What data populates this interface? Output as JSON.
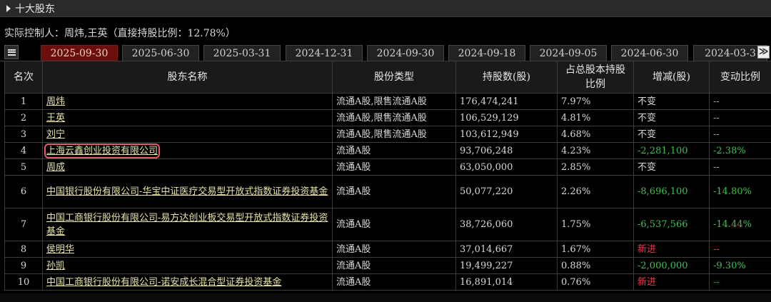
{
  "section": {
    "title": "十大股东"
  },
  "controller": {
    "text": "实际控制人：周炜,王英（直接持股比例：12.78%）"
  },
  "tabs": [
    {
      "label": "2025-09-30",
      "active": true
    },
    {
      "label": "2025-06-30",
      "active": false
    },
    {
      "label": "2025-03-31",
      "active": false
    },
    {
      "label": "2024-12-31",
      "active": false
    },
    {
      "label": "2024-09-30",
      "active": false
    },
    {
      "label": "2024-09-18",
      "active": false
    },
    {
      "label": "2024-09-05",
      "active": false
    },
    {
      "label": "2024-06-30",
      "active": false
    },
    {
      "label": "2024-03-3",
      "active": false
    }
  ],
  "next_label": "≫",
  "table": {
    "headers": {
      "rank": "名次",
      "name": "股东名称",
      "type": "股份类型",
      "shares": "持股数(股)",
      "ratio": "占总股本持股比例",
      "change": "增减(股)",
      "change_pct": "变动比例"
    },
    "rows": [
      {
        "rank": "1",
        "name": "周炜",
        "type": "流通A股,限售流通A股",
        "shares": "176,474,241",
        "ratio": "7.97%",
        "change": "不变",
        "change_pct": "--"
      },
      {
        "rank": "2",
        "name": "王英",
        "type": "流通A股,限售流通A股",
        "shares": "106,529,129",
        "ratio": "4.81%",
        "change": "不变",
        "change_pct": "--"
      },
      {
        "rank": "3",
        "name": "刘宁",
        "type": "流通A股,限售流通A股",
        "shares": "103,612,949",
        "ratio": "4.68%",
        "change": "不变",
        "change_pct": "--"
      },
      {
        "rank": "4",
        "name": "上海云鑫创业投资有限公司",
        "type": "流通A股",
        "shares": "93,706,248",
        "ratio": "4.23%",
        "change": "-2,281,100",
        "change_pct": "-2.38%"
      },
      {
        "rank": "5",
        "name": "周成",
        "type": "流通A股",
        "shares": "63,050,000",
        "ratio": "2.85%",
        "change": "不变",
        "change_pct": "--"
      },
      {
        "rank": "6",
        "name": "中国银行股份有限公司-华宝中证医疗交易型开放式指数证券投资基金",
        "type": "流通A股",
        "shares": "50,077,220",
        "ratio": "2.26%",
        "change": "-8,696,100",
        "change_pct": "-14.80%"
      },
      {
        "rank": "7",
        "name": "中国工商银行股份有限公司-易方达创业板交易型开放式指数证券投资基金",
        "type": "流通A股",
        "shares": "38,726,060",
        "ratio": "1.75%",
        "change": "-6,537,566",
        "change_pct": "-14.44%"
      },
      {
        "rank": "8",
        "name": "侯明华",
        "type": "流通A股",
        "shares": "37,014,667",
        "ratio": "1.67%",
        "change": "新进",
        "change_pct": "--"
      },
      {
        "rank": "9",
        "name": "孙凯",
        "type": "流通A股",
        "shares": "19,499,227",
        "ratio": "0.88%",
        "change": "-2,000,000",
        "change_pct": "-9.30%"
      },
      {
        "rank": "10",
        "name": "中国工商银行股份有限公司-诺安成长混合型证券投资基金",
        "type": "流通A股",
        "shares": "16,891,014",
        "ratio": "0.76%",
        "change": "新进",
        "change_pct": "--"
      }
    ]
  },
  "colors": {
    "decrease": "#3fbf4f",
    "new": "#e8384a",
    "link": "#e8e3a8",
    "active_tab": "#6b0e0e",
    "highlight_box": "#e85a6a"
  }
}
